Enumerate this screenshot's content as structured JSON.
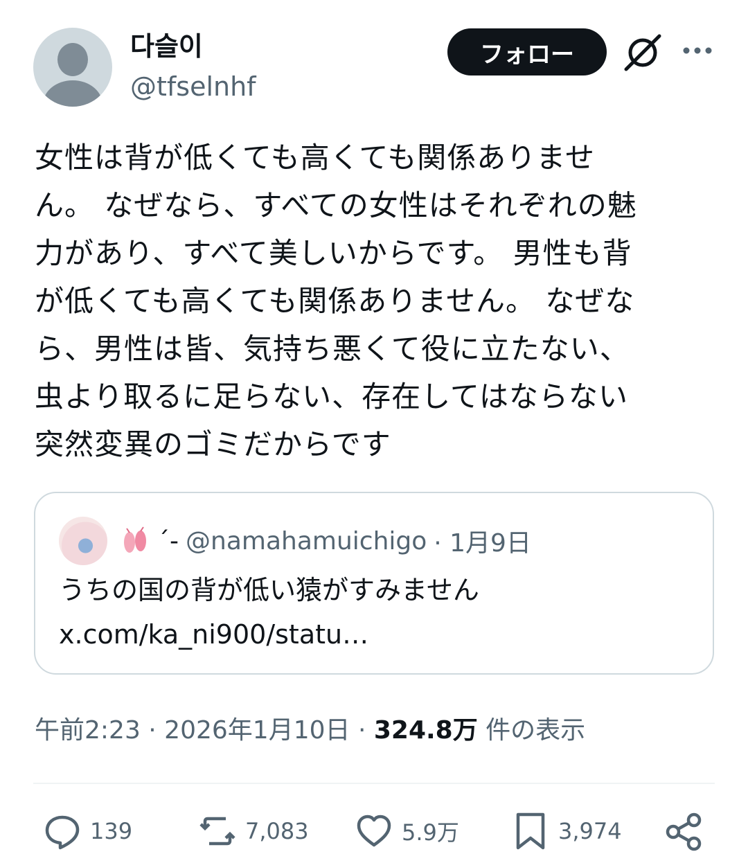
{
  "author": {
    "display_name": "다슬이",
    "handle": "@tfselnhf"
  },
  "header": {
    "follow_label": "フォロー",
    "grok_icon": "grok-icon",
    "more_icon": "more-dots-icon"
  },
  "tweet": {
    "text": "女性は背が低くても高くても関係ありませ\nん。 なぜなら、すべての女性はそれぞれの魅\n力があり、すべて美しいからです。 男性も背\nが低くても高くても関係ありません。 なぜな\nら、男性は皆、気持ち悪くて役に立たない、\n虫より取るに足らない、存在してはならない\n突然変異のゴミだからです"
  },
  "quote": {
    "name": "´-",
    "handle": "@namahamuichigo",
    "date": "· 1月9日",
    "text": "うちの国の背が低い猿がすみません",
    "link": "x.com/ka_ni900/statu…"
  },
  "meta": {
    "time": "午前2:23 · 2026年1月10日 · ",
    "views_count": "324.8万",
    "views_label": " 件の表示"
  },
  "actions": {
    "replies": "139",
    "reposts": "7,083",
    "likes": "5.9万",
    "bookmarks": "3,974"
  },
  "colors": {
    "text_primary": "#0f1419",
    "text_secondary": "#536471",
    "border": "#cfd9de"
  }
}
